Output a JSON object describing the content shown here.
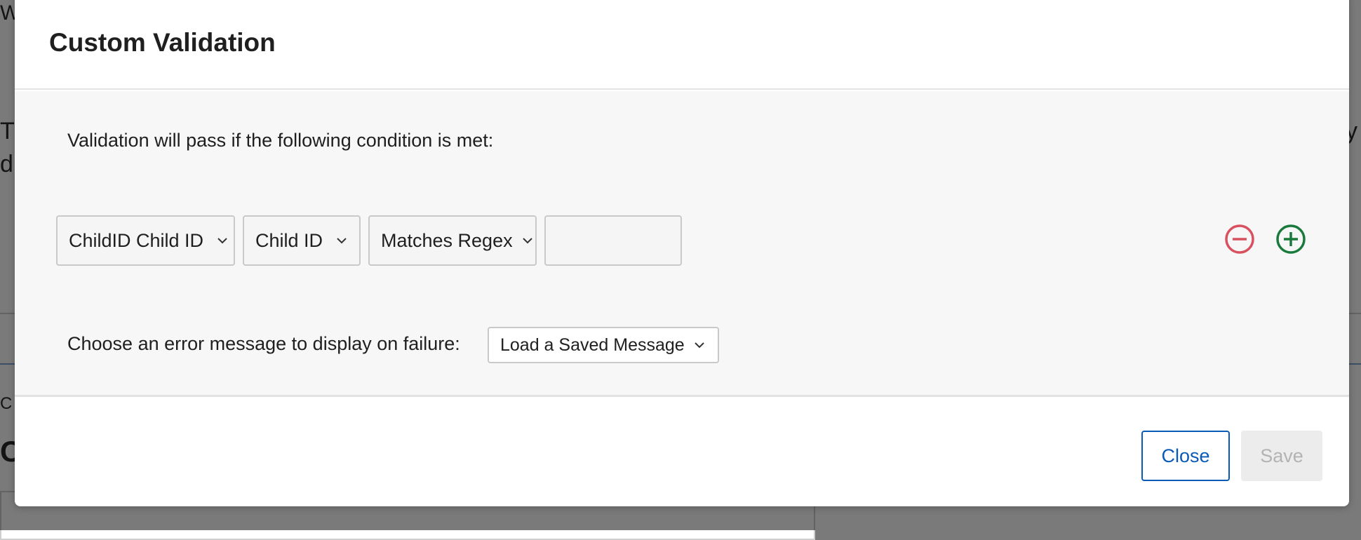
{
  "background": {
    "fragments": [
      "W",
      "T",
      "d",
      "C",
      "C",
      "y"
    ]
  },
  "modal": {
    "title": "Custom Validation",
    "lead_text": "Validation will pass if the following condition is met:",
    "condition": {
      "field_select": "ChildID Child ID",
      "subfield_select": "Child ID",
      "operator_select": "Matches Regex",
      "value_input": ""
    },
    "remove_icon": "minus-circle-icon",
    "add_icon": "plus-circle-icon",
    "error_label": "Choose an error message to display on failure:",
    "error_message_select": "Load a Saved Message",
    "close_label": "Close",
    "save_label": "Save"
  },
  "colors": {
    "remove": "#d9505f",
    "add": "#1a7a3c",
    "primary": "#0a5bb8",
    "disabled_text": "#b3b3b3"
  }
}
